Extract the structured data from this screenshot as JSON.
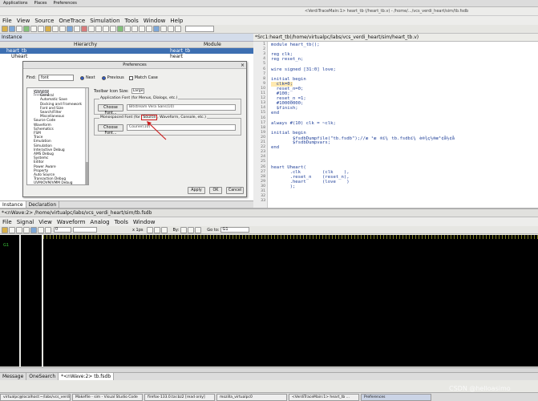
{
  "system_bar": {
    "items": [
      "Applications",
      "Places",
      "Preferences"
    ]
  },
  "window_title": "<VerdiTraceMain:1> heart_tb (/heart_tb.v) - /home/.../vcs_verdi_heart/sim/tb.fsdb",
  "menu": [
    "File",
    "View",
    "Source",
    "OneTrace",
    "Simulation",
    "Tools",
    "Window",
    "Help"
  ],
  "instance_pane": {
    "title": "Instance",
    "col_hierarchy": "Hierarchy",
    "col_module": "Module",
    "rows": [
      {
        "name": "heart_tb",
        "module": "heart_tb",
        "selected": true
      },
      {
        "name": "Uheart",
        "module": "heart",
        "selected": false
      }
    ]
  },
  "instance_tabs": [
    "Instance",
    "Declaration"
  ],
  "source_pane": {
    "title": "*Src1:heart_tb(/home/virtualpc/labs/vcs_verdi_heart/sim/heart_tb.v)",
    "line_numbers": [
      "1",
      "2",
      "3",
      "4",
      "5",
      "6",
      "7",
      "8",
      "9",
      "10",
      "11",
      "12",
      "13",
      "14",
      "15",
      "16",
      "17",
      "18",
      "19",
      "20",
      "21",
      "22",
      "23",
      "24",
      "25",
      "26",
      "27",
      "28",
      "29",
      "30",
      "31",
      "32",
      "33"
    ],
    "lines": [
      "module heart_tb();",
      "",
      "reg clk;",
      "reg reset_n;",
      "",
      "wire signed [31:0] love;",
      "",
      "initial begin",
      "  clk=0;",
      "  reset_n=0;",
      "  #100;",
      "  reset_n =1;",
      "  #10000000;",
      "  $finish;",
      "end",
      "",
      "always #(10) clk = ~clk;",
      "",
      "initial begin",
      "        $fsdbDumpfile(\"tb.fsdb\");//æ ¹æ®ï¼tb.fsdbï¼è®¾ç½®æ³¢å½¢å",
      "        $fsdbDumpvars;",
      "end",
      "",
      "",
      "",
      "heart Uheart(",
      "       .clk        (clk    ),",
      "       .reset_n    (reset_n),",
      "       .heart      (love    )",
      "       );",
      "",
      "",
      ""
    ]
  },
  "dialog": {
    "title": "Preferences",
    "find_label": "Find:",
    "find_value": "font",
    "radio_next": "Next",
    "radio_previous": "Previous",
    "match_case": "Match Case",
    "tree": [
      "General",
      "General",
      "Automatic Save",
      "Docking and Framework",
      "Font and Size",
      "Search/Filter",
      "Miscellaneous",
      "Source Code",
      "Waveform",
      "Schematics",
      "FSM",
      "Trace",
      "Emulation",
      "Simulation",
      "Interactive Debug",
      "AMS Debug",
      "Systemc",
      "Editor",
      "Power Aware",
      "Property",
      "Auto Source",
      "Transaction Debug",
      "UVM/OVM/VMM Debug"
    ],
    "toolbar_icon_size_label": "Toolbar Icon Size:",
    "toolbar_icon_size_value": "Large",
    "app_font_group": "Application Font (for Menus, Dialogs, etc.)",
    "app_font_button": "Choose Font...",
    "app_font_value": "Bitstream Vera Sans(10)",
    "mono_font_group_prefix": "Monospaced Font (for ",
    "mono_font_group_highlight": "Source",
    "mono_font_group_suffix": ", Waveform, Console, etc.)",
    "mono_font_button": "Choose Font...",
    "mono_font_value": "Courier(10)",
    "apply": "Apply",
    "ok": "OK",
    "cancel": "Cancel"
  },
  "nwave": {
    "title": "*<nWave:2> /home/virtualpc/labs/vcs_verdi_heart/sim/tb.fsdb",
    "menu": [
      "File",
      "Signal",
      "View",
      "Waveform",
      "Analog",
      "Tools",
      "Window"
    ],
    "time_value": "0",
    "unit": "x 1ps",
    "by_label": "By:",
    "goto_label": "Go to:",
    "goto_value": "G1",
    "group": "G1"
  },
  "bottom_tabs": [
    "Message",
    "OneSearch",
    "*<nWave:2> tb.fsdb"
  ],
  "taskbar": [
    "virtualpc@localhost:~/labs/vcs_verdi...",
    "Makefile - sim - Visual Studio Code",
    "firefox-133.0.tar.bz2 [read only]",
    "mozilla_virtualpc0",
    "<VerdiTraceMain:1> heart_tb ...",
    "Preferences"
  ],
  "watermark": "CSDN @helloasimo",
  "colors": {
    "selection": "#3d6fb2",
    "code": "#1f3f98",
    "annotation": "#cc1f1f",
    "wave_bg": "#000000"
  }
}
